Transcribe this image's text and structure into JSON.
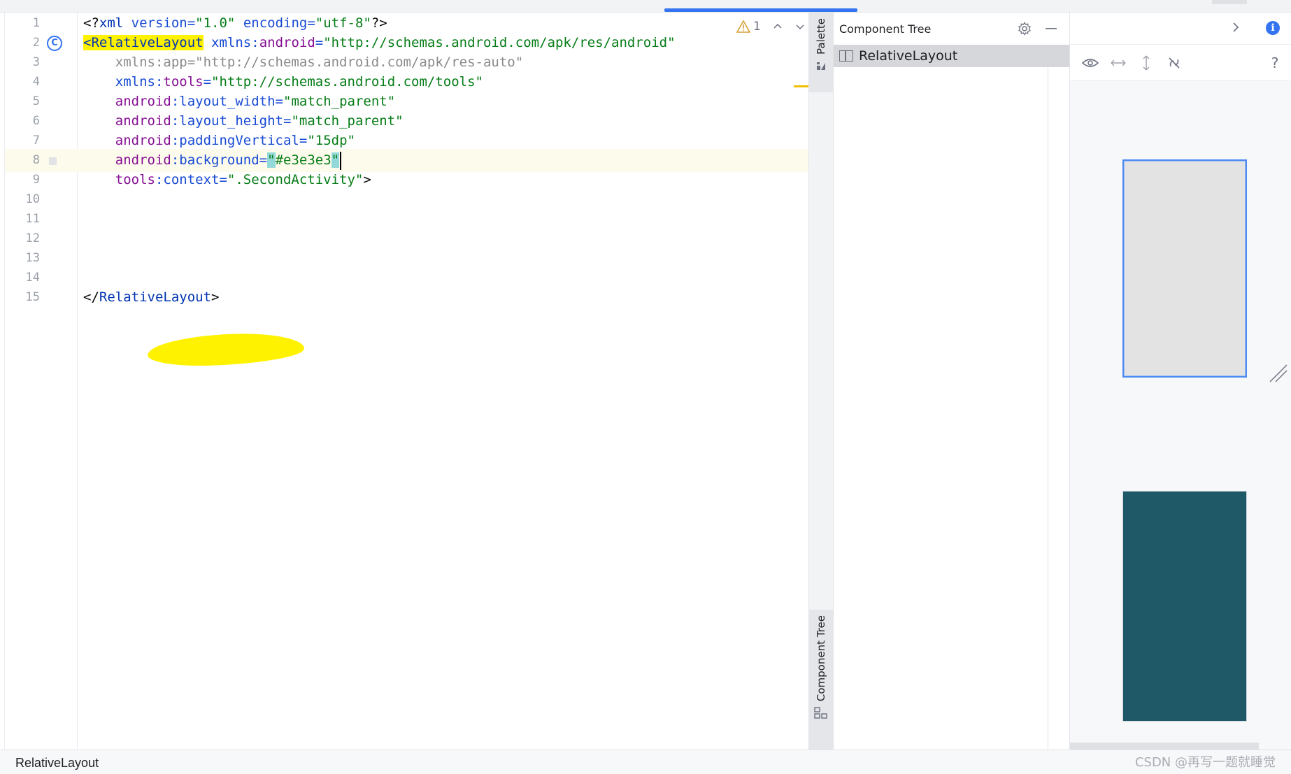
{
  "editor": {
    "lines": [
      {
        "n": "1",
        "tokens": [
          {
            "t": "<?",
            "c": "c-punct"
          },
          {
            "t": "xml",
            "c": "c-tag"
          },
          {
            "t": " version=",
            "c": "c-attr"
          },
          {
            "t": "\"1.0\"",
            "c": "c-val"
          },
          {
            "t": " encoding=",
            "c": "c-attr"
          },
          {
            "t": "\"utf-8\"",
            "c": "c-val"
          },
          {
            "t": "?>",
            "c": "c-punct"
          }
        ]
      },
      {
        "n": "2",
        "tokens": [
          {
            "t": "<RelativeLayout",
            "c": "c-tag hl-tag"
          },
          {
            "t": " ",
            "c": "c-punct"
          },
          {
            "t": "xmlns:",
            "c": "c-attr"
          },
          {
            "t": "android",
            "c": "c-ns"
          },
          {
            "t": "=",
            "c": "c-attr"
          },
          {
            "t": "\"http://schemas.android.com/apk/res/android\"",
            "c": "c-val"
          }
        ]
      },
      {
        "n": "3",
        "tokens": [
          {
            "t": "    xmlns:app=\"http://schemas.android.com/apk/res-auto\"",
            "c": "c-dim"
          }
        ]
      },
      {
        "n": "4",
        "tokens": [
          {
            "t": "    xmlns:",
            "c": "c-attr"
          },
          {
            "t": "tools",
            "c": "c-ns"
          },
          {
            "t": "=",
            "c": "c-attr"
          },
          {
            "t": "\"http://schemas.android.com/tools\"",
            "c": "c-val"
          }
        ]
      },
      {
        "n": "5",
        "tokens": [
          {
            "t": "    android",
            "c": "c-ns"
          },
          {
            "t": ":layout_width=",
            "c": "c-attr"
          },
          {
            "t": "\"match_parent\"",
            "c": "c-val"
          }
        ]
      },
      {
        "n": "6",
        "tokens": [
          {
            "t": "    android",
            "c": "c-ns"
          },
          {
            "t": ":layout_height=",
            "c": "c-attr"
          },
          {
            "t": "\"match_parent\"",
            "c": "c-val"
          }
        ]
      },
      {
        "n": "7",
        "tokens": [
          {
            "t": "    android",
            "c": "c-ns"
          },
          {
            "t": ":paddingVertical=",
            "c": "c-attr"
          },
          {
            "t": "\"15dp\"",
            "c": "c-val"
          }
        ]
      },
      {
        "n": "8",
        "tokens": [
          {
            "t": "    android",
            "c": "c-ns"
          },
          {
            "t": ":background=",
            "c": "c-attr"
          },
          {
            "t": "\"",
            "c": "c-val brace-hl"
          },
          {
            "t": "#e3e3e3",
            "c": "c-val"
          },
          {
            "t": "\"",
            "c": "c-val brace-hl"
          }
        ],
        "current": true,
        "caret": true
      },
      {
        "n": "9",
        "tokens": [
          {
            "t": "    tools",
            "c": "c-ns"
          },
          {
            "t": ":context=",
            "c": "c-attr"
          },
          {
            "t": "\".SecondActivity\"",
            "c": "c-val"
          },
          {
            "t": ">",
            "c": "c-punct"
          }
        ]
      },
      {
        "n": "10",
        "tokens": []
      },
      {
        "n": "11",
        "tokens": []
      },
      {
        "n": "12",
        "tokens": []
      },
      {
        "n": "13",
        "tokens": []
      },
      {
        "n": "14",
        "tokens": []
      },
      {
        "n": "15",
        "tokens": [
          {
            "t": "</",
            "c": "c-punct"
          },
          {
            "t": "RelativeLayout",
            "c": "c-tag"
          },
          {
            "t": ">",
            "c": "c-punct"
          }
        ]
      }
    ],
    "inspection_count": "1"
  },
  "side_strip": {
    "palette_label": "Palette",
    "component_tree_label": "Component Tree"
  },
  "component_tree": {
    "title": "Component Tree",
    "rows": [
      {
        "label": "RelativeLayout"
      }
    ]
  },
  "design": {
    "help_label": "?",
    "info_label": "i",
    "blueprint_color": "#e3e3e3",
    "dark_preview_color": "#1f5968"
  },
  "statusbar": {
    "breadcrumb": "RelativeLayout"
  },
  "watermark": "CSDN @再写一题就睡觉",
  "colors": {
    "accent": "#3574f0",
    "highlight": "#fff200",
    "current_line": "#fdfbec"
  }
}
